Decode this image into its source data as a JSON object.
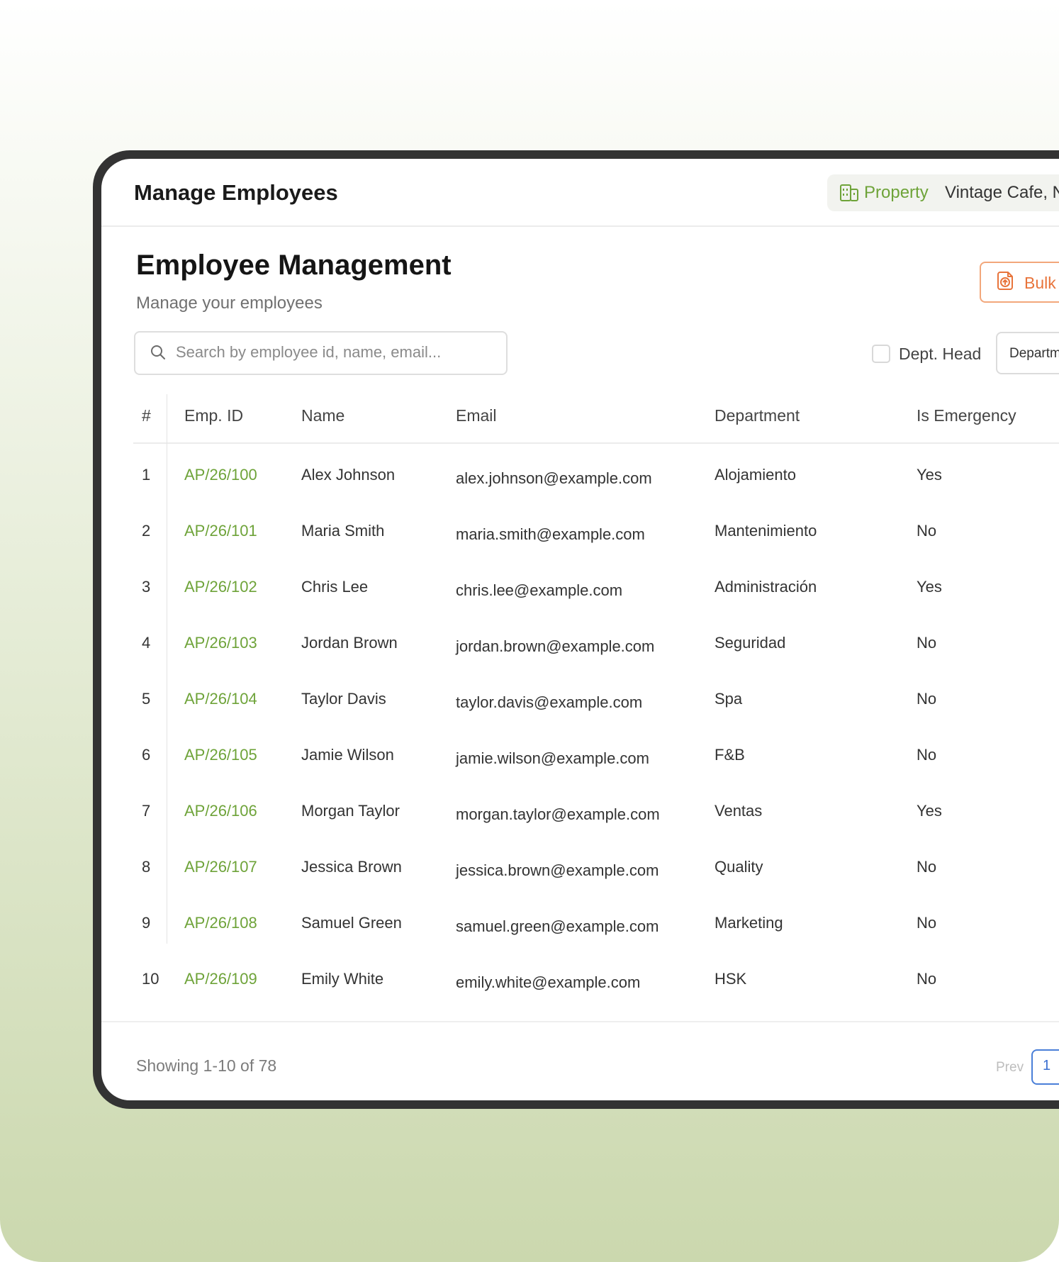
{
  "header": {
    "app_title": "Manage Employees",
    "property_label": "Property",
    "property_value": "Vintage Cafe, N"
  },
  "page": {
    "title": "Employee Management",
    "subtitle": "Manage your employees",
    "bulk_button_label": "Bulk"
  },
  "filters": {
    "search_placeholder": "Search by employee id, name, email...",
    "dept_head_label": "Dept. Head",
    "department_select": "Departm"
  },
  "table": {
    "columns": [
      "#",
      "Emp. ID",
      "Name",
      "Email",
      "Department",
      "Is Emergency"
    ],
    "rows": [
      {
        "num": "1",
        "id": "AP/26/100",
        "name": "Alex Johnson",
        "email": "alex.johnson@example.com",
        "dept": "Alojamiento",
        "emergency": "Yes"
      },
      {
        "num": "2",
        "id": "AP/26/101",
        "name": "Maria Smith",
        "email": "maria.smith@example.com",
        "dept": "Mantenimiento",
        "emergency": "No"
      },
      {
        "num": "3",
        "id": "AP/26/102",
        "name": "Chris Lee",
        "email": "chris.lee@example.com",
        "dept": "Administración",
        "emergency": "Yes"
      },
      {
        "num": "4",
        "id": "AP/26/103",
        "name": "Jordan Brown",
        "email": "jordan.brown@example.com",
        "dept": "Seguridad",
        "emergency": "No"
      },
      {
        "num": "5",
        "id": "AP/26/104",
        "name": "Taylor Davis",
        "email": "taylor.davis@example.com",
        "dept": "Spa",
        "emergency": "No"
      },
      {
        "num": "6",
        "id": "AP/26/105",
        "name": "Jamie Wilson",
        "email": "jamie.wilson@example.com",
        "dept": "F&B",
        "emergency": "No"
      },
      {
        "num": "7",
        "id": "AP/26/106",
        "name": "Morgan Taylor",
        "email": "morgan.taylor@example.com",
        "dept": "Ventas",
        "emergency": "Yes"
      },
      {
        "num": "8",
        "id": "AP/26/107",
        "name": "Jessica Brown",
        "email": "jessica.brown@example.com",
        "dept": "Quality",
        "emergency": "No"
      },
      {
        "num": "9",
        "id": "AP/26/108",
        "name": "Samuel Green",
        "email": "samuel.green@example.com",
        "dept": "Marketing",
        "emergency": "No"
      },
      {
        "num": "10",
        "id": "AP/26/109",
        "name": "Emily White",
        "email": "emily.white@example.com",
        "dept": "HSK",
        "emergency": "No"
      }
    ]
  },
  "footer": {
    "showing": "Showing 1-10 of 78",
    "prev_label": "Prev",
    "current_page": "1"
  },
  "colors": {
    "accent_green": "#6ea339",
    "accent_orange": "#e8743b",
    "pagination_blue": "#3a6fd0",
    "frame": "#333333"
  },
  "icons": {
    "property": "building-icon",
    "bulk": "upload-file-icon",
    "search": "search-icon"
  }
}
